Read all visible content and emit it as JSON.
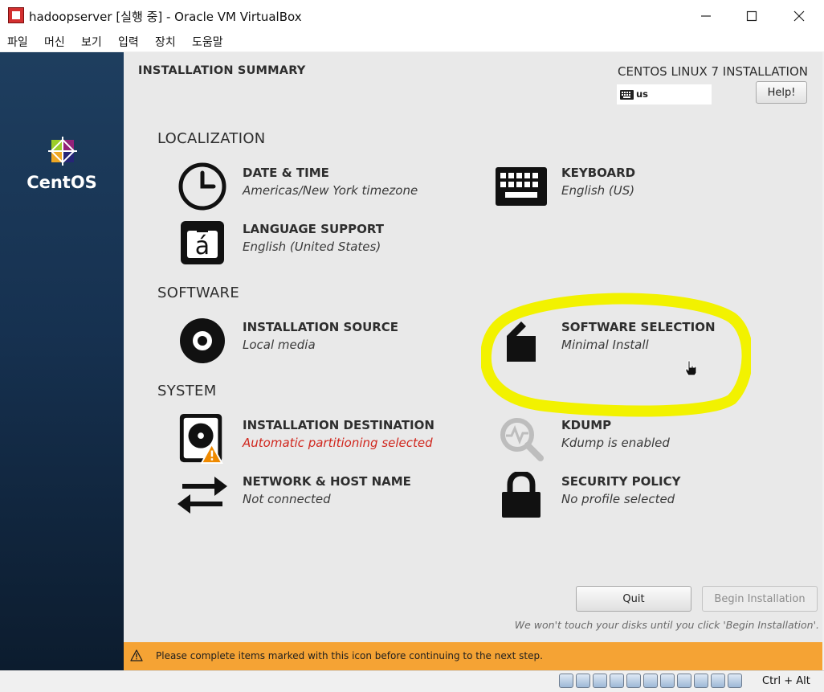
{
  "window": {
    "title": "hadoopserver [실행 중] - Oracle VM VirtualBox",
    "minimize_icon": "minimize-icon",
    "maximize_icon": "maximize-icon",
    "close_icon": "close-icon"
  },
  "menubar": {
    "items": [
      "파일",
      "머신",
      "보기",
      "입력",
      "장치",
      "도움말"
    ]
  },
  "sidebar": {
    "brand": "CentOS"
  },
  "header": {
    "title": "INSTALLATION SUMMARY",
    "product": "CENTOS LINUX 7 INSTALLATION",
    "keyboard_layout": "us",
    "help_label": "Help!"
  },
  "sections": {
    "localization": "LOCALIZATION",
    "software": "SOFTWARE",
    "system": "SYSTEM"
  },
  "spokes": {
    "date_time": {
      "title": "DATE & TIME",
      "status": "Americas/New York timezone",
      "icon": "clock-icon"
    },
    "keyboard": {
      "title": "KEYBOARD",
      "status": "English (US)",
      "icon": "keyboard-icon"
    },
    "language": {
      "title": "LANGUAGE SUPPORT",
      "status": "English (United States)",
      "icon": "language-icon"
    },
    "source": {
      "title": "INSTALLATION SOURCE",
      "status": "Local media",
      "icon": "disc-icon"
    },
    "software": {
      "title": "SOFTWARE SELECTION",
      "status": "Minimal Install",
      "icon": "package-icon"
    },
    "destination": {
      "title": "INSTALLATION DESTINATION",
      "status": "Automatic partitioning selected",
      "icon": "hard-disk-icon"
    },
    "kdump": {
      "title": "KDUMP",
      "status": "Kdump is enabled",
      "icon": "kdump-search-icon"
    },
    "network": {
      "title": "NETWORK & HOST NAME",
      "status": "Not connected",
      "icon": "network-arrows-icon"
    },
    "security": {
      "title": "SECURITY POLICY",
      "status": "No profile selected",
      "icon": "lock-icon"
    }
  },
  "actions": {
    "quit_label": "Quit",
    "begin_label": "Begin Installation",
    "note": "We won't touch your disks until you click 'Begin Installation'."
  },
  "warning": {
    "text": "Please complete items marked with this icon before continuing to the next step."
  },
  "statusbar": {
    "host_key": "Ctrl + Alt"
  },
  "colors": {
    "sidebar": "#163150",
    "content_bg": "#e9e9e9",
    "warning_bar": "#f5a334",
    "warning_text": "#d0261d",
    "highlight": "#f2f200"
  }
}
